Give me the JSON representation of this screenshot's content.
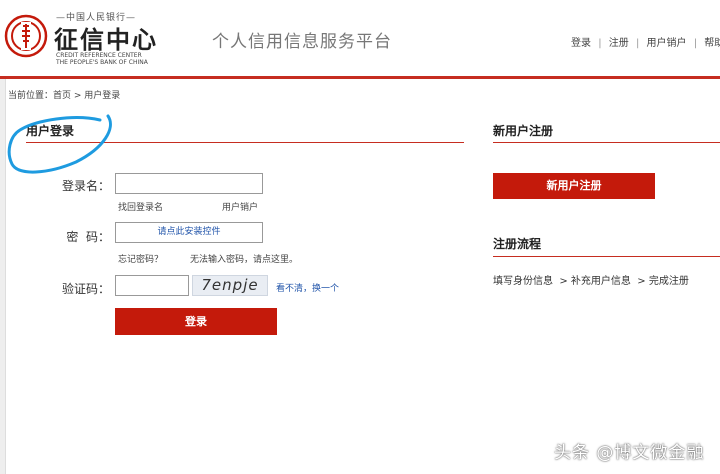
{
  "header": {
    "logo_top": "—中国人民银行—",
    "logo_main": "征信中心",
    "logo_en_line1": "CREDIT REFERENCE CENTER",
    "logo_en_line2": "THE PEOPLE'S BANK OF CHINA",
    "platform_title": "个人信用信息服务平台",
    "nav": {
      "login": "登录",
      "sep1": "|",
      "register": "注册",
      "sep2": "|",
      "cancel": "用户销户",
      "sep3": "|",
      "help": "帮助中心"
    }
  },
  "breadcrumb": "当前位置：首页 > 用户登录",
  "login": {
    "title": "用户登录",
    "username_label": "登录名：",
    "username_value": "",
    "find_username": "找回登录名",
    "cancel_account": "用户销户",
    "password_label": "密  码：",
    "password_prompt": "请点此安装控件",
    "forgot_password": "忘记密码？",
    "cannot_input": "无法输入密码，请点这里。",
    "captcha_label": "验证码：",
    "captcha_value": "",
    "captcha_text": "7enpje",
    "captcha_refresh": "看不清，换一个",
    "submit": "登录"
  },
  "register": {
    "title": "新用户注册",
    "button": "新用户注册",
    "flow_title": "注册流程",
    "flow_steps": "填写身份信息  > 补充用户信息  > 完成注册"
  },
  "watermark": "头条 @博文微金融",
  "colors": {
    "accent": "#c41a0b",
    "rule": "#c62d20",
    "link": "#2255aa",
    "annotation": "#1e9be0"
  },
  "icons": {
    "logo": "bank-seal-logo-icon",
    "annotation": "hand-drawn-circle-annotation"
  }
}
